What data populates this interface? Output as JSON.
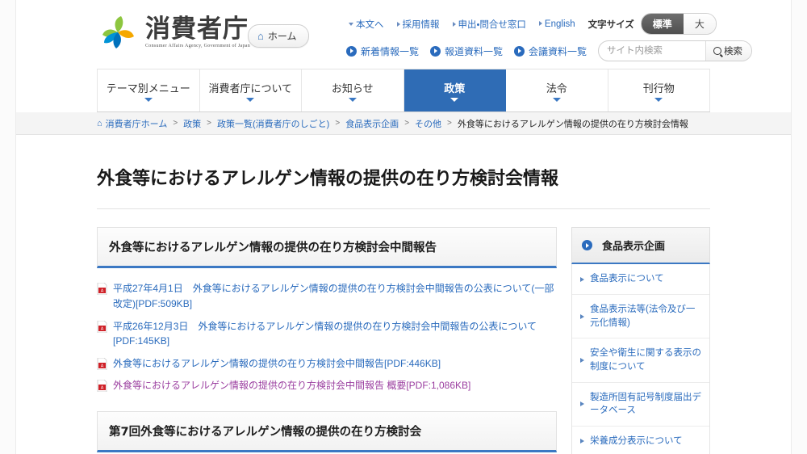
{
  "header": {
    "logo_jp": "消費者庁",
    "logo_en": "Consumer Affairs Agency, Government of Japan",
    "logo_icon": "pinwheel-logo-icon",
    "home_button": "ホーム",
    "home_icon": "home-icon"
  },
  "utility_links": [
    {
      "label": "本文へ",
      "marker": "caret-down"
    },
    {
      "label": "採用情報",
      "marker": "caret-right"
    },
    {
      "label": "申出・問合せ窓口",
      "marker": "caret-right"
    },
    {
      "label": "English",
      "marker": "caret-right"
    }
  ],
  "font_size": {
    "label": "文字サイズ",
    "options": [
      "標準",
      "大"
    ],
    "selected": "標準"
  },
  "quick_links": [
    {
      "label": "新着情報一覧"
    },
    {
      "label": "報道資料一覧"
    },
    {
      "label": "会議資料一覧"
    }
  ],
  "search": {
    "placeholder": "サイト内検索",
    "value": "",
    "button_label": "検索",
    "button_icon": "search-icon"
  },
  "global_nav": {
    "items": [
      {
        "label": "テーマ別メニュー",
        "active": false
      },
      {
        "label": "消費者庁について",
        "active": false
      },
      {
        "label": "お知らせ",
        "active": false
      },
      {
        "label": "政策",
        "active": true
      },
      {
        "label": "法令",
        "active": false
      },
      {
        "label": "刊行物",
        "active": false
      }
    ],
    "active_color": "#2f6cb5"
  },
  "breadcrumb": {
    "home_icon": "home-icon",
    "items": [
      "消費者庁ホーム",
      "政策",
      "政策一覧(消費者庁のしごと)",
      "食品表示企画",
      "その他"
    ],
    "separator": ">",
    "current": "外食等におけるアレルゲン情報の提供の在り方検討会情報"
  },
  "page_title": "外食等におけるアレルゲン情報の提供の在り方検討会情報",
  "sections": [
    {
      "heading": "外食等におけるアレルゲン情報の提供の在り方検討会中間報告",
      "links": [
        {
          "text": "平成27年4月1日　外食等におけるアレルゲン情報の提供の在り方検討会中間報告の公表について(一部改定)[PDF:509KB]",
          "icon": "pdf-icon",
          "visited": false
        },
        {
          "text": "平成26年12月3日　外食等におけるアレルゲン情報の提供の在り方検討会中間報告の公表について[PDF:145KB]",
          "icon": "pdf-icon",
          "visited": false
        },
        {
          "text": "外食等におけるアレルゲン情報の提供の在り方検討会中間報告[PDF:446KB]",
          "icon": "pdf-icon",
          "visited": false
        },
        {
          "text": "外食等におけるアレルゲン情報の提供の在り方検討会中間報告 概要[PDF:1,086KB]",
          "icon": "pdf-icon",
          "visited": true
        }
      ]
    },
    {
      "heading": "第7回外食等におけるアレルゲン情報の提供の在り方検討会",
      "links": []
    }
  ],
  "sidebar": {
    "heading": "食品表示企画",
    "heading_icon": "circle-arrow-icon",
    "items": [
      {
        "label": "食品表示について"
      },
      {
        "label": "食品表示法等(法令及び一元化情報)"
      },
      {
        "label": "安全や衛生に関する表示の制度について"
      },
      {
        "label": "製造所固有記号制度届出データベース"
      },
      {
        "label": "栄養成分表示について"
      }
    ]
  },
  "colors": {
    "link": "#2a6bbd",
    "visited_link": "#9b3fa0",
    "accent": "#3b78c3",
    "nav_active": "#2f6cb5",
    "pdf_icon": "#cf2027"
  }
}
